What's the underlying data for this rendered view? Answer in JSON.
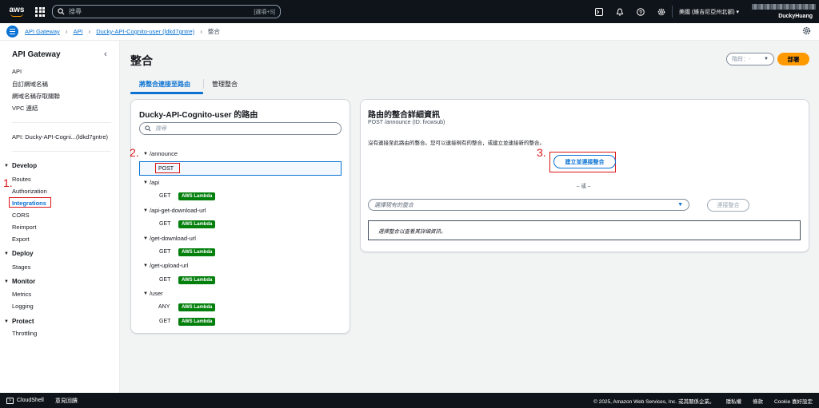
{
  "topnav": {
    "logo_text": "aws",
    "search_placeholder": "搜尋",
    "search_shortcut": "[選項+S]",
    "region": "美國 (維吉尼亞州北部) ▾",
    "user": "DuckyHuang"
  },
  "breadcrumb": [
    "API Gateway",
    "API",
    "Ducky-API-Cognito-user (ldkd7gntre)",
    "整合"
  ],
  "sidebar": {
    "title": "API Gateway",
    "top_items": [
      "API",
      "自訂網域名稱",
      "網域名稱存取關聯",
      "VPC 連結"
    ],
    "api_name": "API: Ducky-API-Cogni...(ldkd7gntre)",
    "sections": [
      {
        "name": "Develop",
        "items": [
          "Routes",
          "Authorization",
          "Integrations",
          "CORS",
          "Reimport",
          "Export"
        ]
      },
      {
        "name": "Deploy",
        "items": [
          "Stages"
        ]
      },
      {
        "name": "Monitor",
        "items": [
          "Metrics",
          "Logging"
        ]
      },
      {
        "name": "Protect",
        "items": [
          "Throttling"
        ]
      }
    ],
    "active_item": "Integrations"
  },
  "page": {
    "title": "整合",
    "stage_placeholder": "階段：-",
    "deploy_label": "部署",
    "tabs": [
      "將整合連接至路由",
      "管理整合"
    ]
  },
  "routes_panel": {
    "title": "Ducky-API-Cognito-user 的路由",
    "search_placeholder": "搜尋",
    "badge_label": "AWS Lambda",
    "routes": [
      {
        "path": "/announce",
        "methods": [
          {
            "method": "POST",
            "badge": ""
          }
        ]
      },
      {
        "path": "/api",
        "methods": [
          {
            "method": "GET",
            "badge": "AWS Lambda"
          }
        ]
      },
      {
        "path": "/api-get-download-url",
        "methods": [
          {
            "method": "GET",
            "badge": "AWS Lambda"
          }
        ]
      },
      {
        "path": "/get-download-url",
        "methods": [
          {
            "method": "GET",
            "badge": "AWS Lambda"
          }
        ]
      },
      {
        "path": "/get-upload-url",
        "methods": [
          {
            "method": "GET",
            "badge": "AWS Lambda"
          }
        ]
      },
      {
        "path": "/user",
        "methods": [
          {
            "method": "ANY",
            "badge": "AWS Lambda"
          },
          {
            "method": "GET",
            "badge": "AWS Lambda"
          }
        ]
      }
    ]
  },
  "detail_panel": {
    "title": "路由的整合詳細資訊",
    "subtitle": "POST /announce (ID: fvcwsub)",
    "message": "沒有連接至此路由的整合。您可以連接現有的整合，或建立並連接新的整合。",
    "create_label": "建立並連接整合",
    "or_label": "– 或 –",
    "select_placeholder": "選擇現有的整合",
    "attach_label": "連接整合",
    "detail_hint": "選擇整合以查看其詳細資訊。"
  },
  "annotations": [
    "1.",
    "2.",
    "3."
  ],
  "bottombar": {
    "cloudshell": "CloudShell",
    "feedback": "意見回饋",
    "copyright": "© 2025, Amazon Web Services, Inc. 或其關係企業。",
    "privacy": "隱私權",
    "terms": "條款",
    "cookie": "Cookie 喜好設定"
  },
  "colors": {
    "accent": "#0972d3",
    "deploy": "#ff9900",
    "lambda": "#037f0c",
    "annotation": "#d91515"
  }
}
